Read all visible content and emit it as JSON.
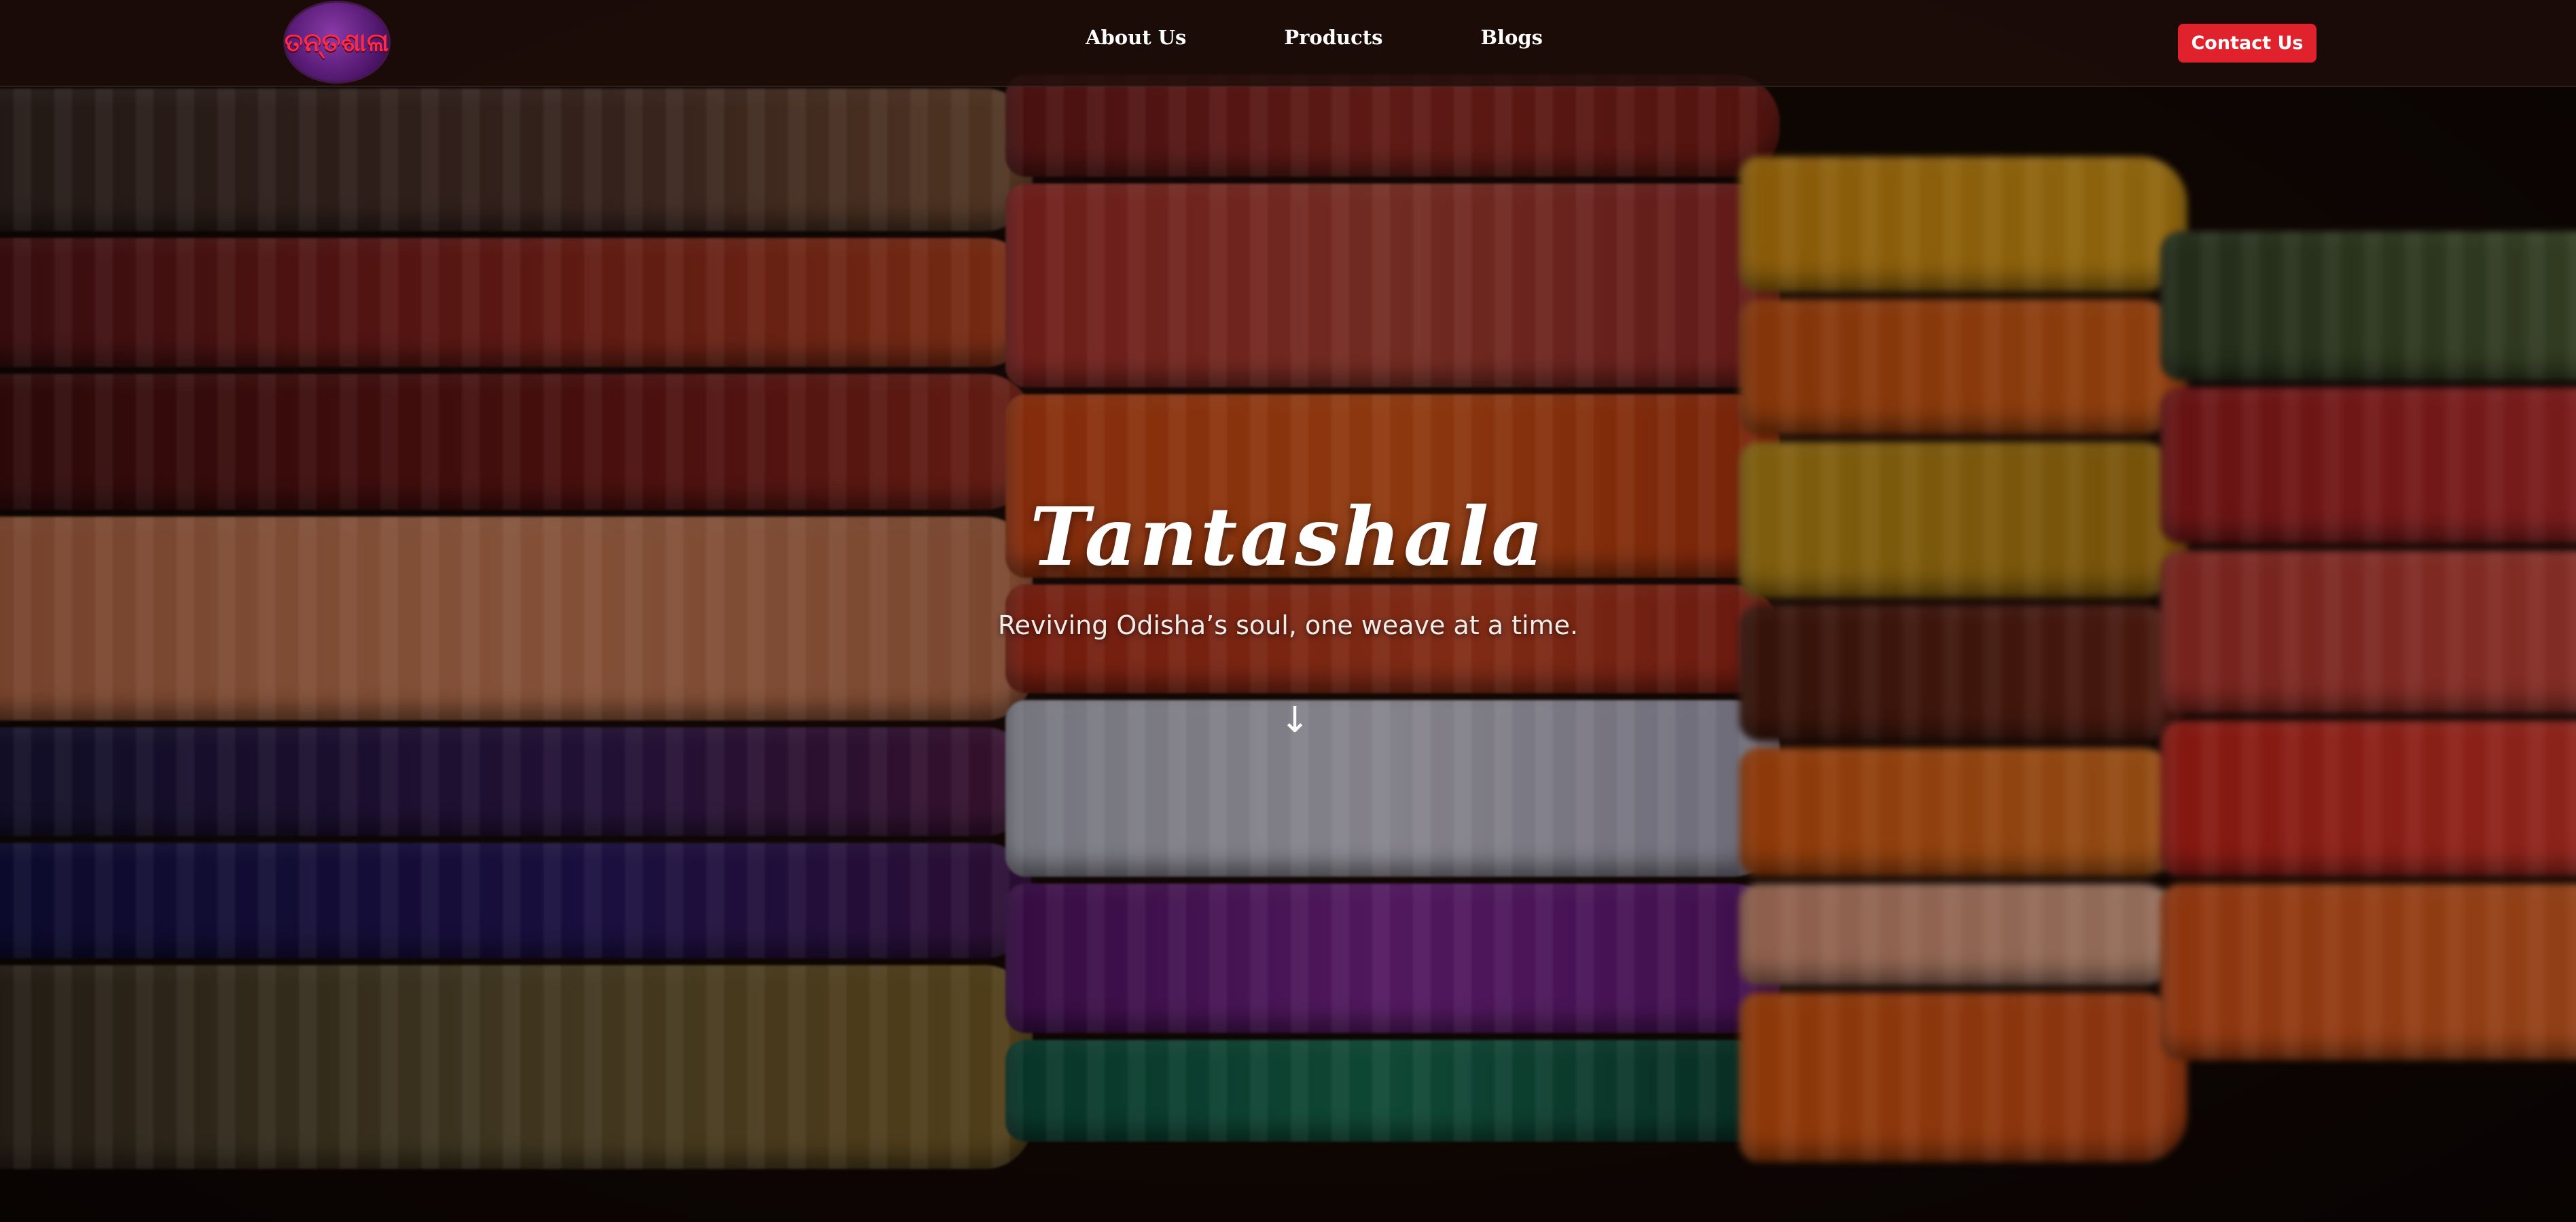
{
  "header": {
    "logo_alt": "Tantashala logo",
    "logo_text": "ତନ୍ତଶାଳା",
    "nav": [
      {
        "label": "About Us"
      },
      {
        "label": "Products"
      },
      {
        "label": "Blogs"
      }
    ],
    "contact_label": "Contact Us"
  },
  "hero": {
    "title": "Tantashala",
    "subtitle": "Reviving Odisha’s soul, one weave at a time.",
    "scroll_icon": "↓"
  },
  "colors": {
    "accent": "#e0222c",
    "header_bg": "#1e0e0a",
    "logo_bg": "#4b1468"
  },
  "icons": {
    "scroll": "arrow-down-icon"
  }
}
